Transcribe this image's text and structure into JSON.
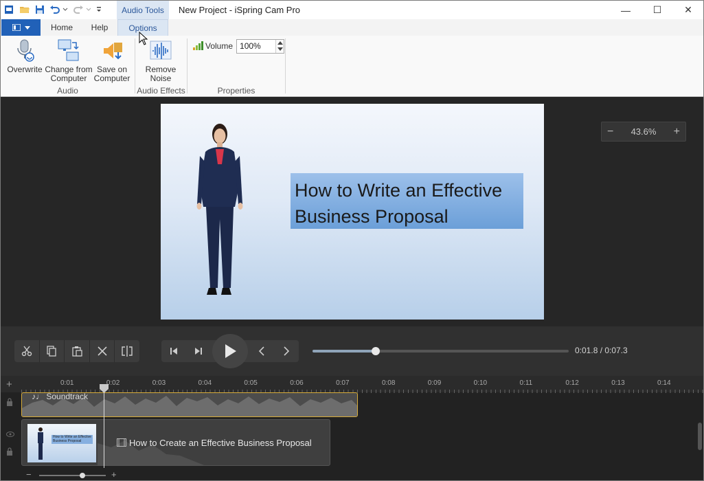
{
  "window": {
    "title": "New Project - iSpring Cam Pro",
    "contextual_tab": "Audio Tools",
    "minimize": "—",
    "maximize": "☐",
    "close": "✕"
  },
  "tabs": {
    "home": "Home",
    "help": "Help",
    "options": "Options"
  },
  "ribbon": {
    "overwrite": "Overwrite",
    "change_line1": "Change from",
    "change_line2": "Computer",
    "save_line1": "Save on",
    "save_line2": "Computer",
    "remove_line1": "Remove",
    "remove_line2": "Noise",
    "group_audio": "Audio",
    "group_effects": "Audio Effects",
    "group_properties": "Properties",
    "volume_label": "Volume",
    "volume_value": "100%"
  },
  "stage": {
    "slide_title": "How to Write an Effective Business Proposal",
    "zoom_value": "43.6%",
    "zoom_minus": "−",
    "zoom_plus": "+"
  },
  "player": {
    "time_readout": "0:01.8 / 0:07.3",
    "current_seconds": 1.8,
    "total_seconds": 7.3
  },
  "timeline": {
    "ticks": [
      "0:01",
      "0:02",
      "0:03",
      "0:04",
      "0:05",
      "0:06",
      "0:07",
      "0:08",
      "0:09",
      "0:10",
      "0:11",
      "0:12",
      "0:13",
      "0:14"
    ],
    "soundtrack_label": "Soundtrack",
    "clip_title": "How to Create an Effective Business Proposal",
    "thumb_title": "How to Write an Effective Business Proposal",
    "zoom_minus": "−",
    "zoom_plus": "+",
    "zoom_level": 0.65
  },
  "colors": {
    "accent": "#2161b8",
    "soundtrack_border": "#d9ad3a"
  }
}
